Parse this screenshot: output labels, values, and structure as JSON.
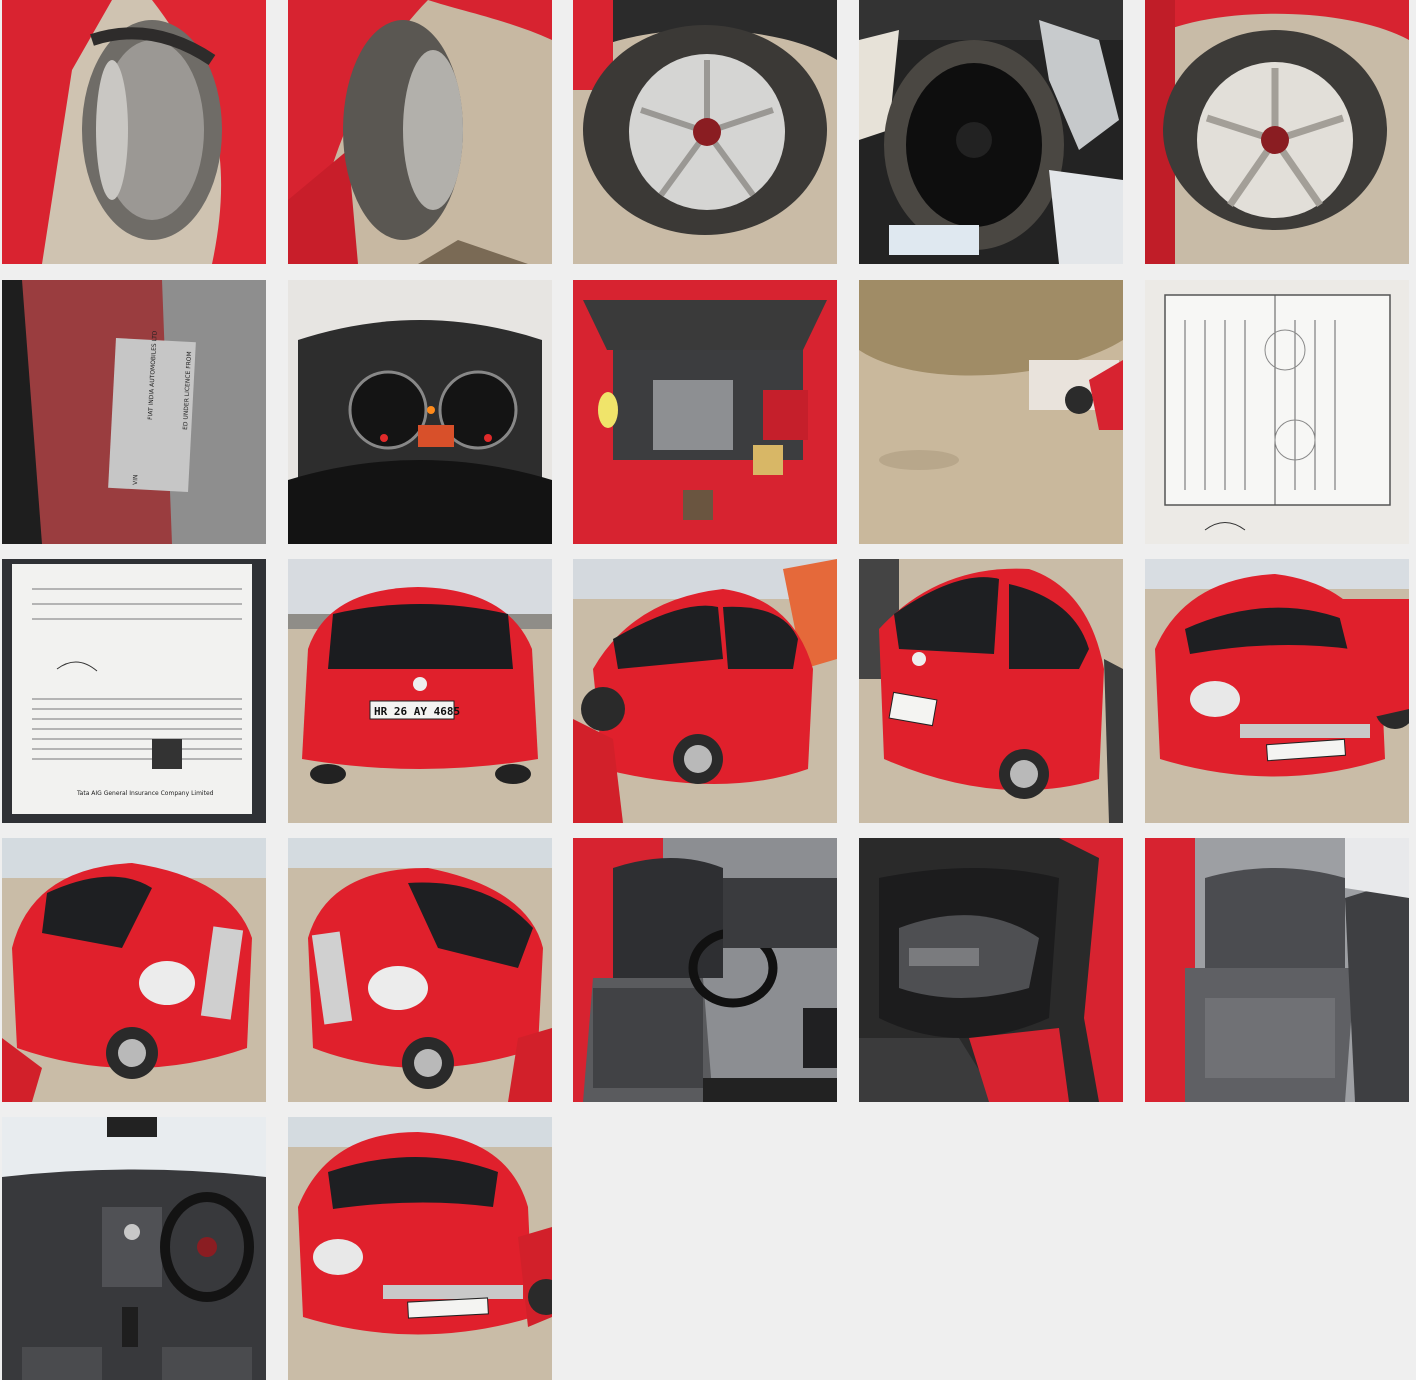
{
  "gallery": {
    "photos": [
      {
        "subject": "front-left-tyre"
      },
      {
        "subject": "front-right-tyre"
      },
      {
        "subject": "rear-tyre-alloy"
      },
      {
        "subject": "spare-wheel"
      },
      {
        "subject": "rear-right-tyre-alloy"
      },
      {
        "subject": "vin-plate"
      },
      {
        "subject": "instrument-cluster"
      },
      {
        "subject": "engine-bay"
      },
      {
        "subject": "underbody"
      },
      {
        "subject": "registration-certificate"
      },
      {
        "subject": "insurance-document"
      },
      {
        "subject": "rear-view"
      },
      {
        "subject": "rear-left-view"
      },
      {
        "subject": "rear-right-view"
      },
      {
        "subject": "front-left-view"
      },
      {
        "subject": "front-right-view"
      },
      {
        "subject": "front-left-angle"
      },
      {
        "subject": "front-cabin"
      },
      {
        "subject": "door-panel"
      },
      {
        "subject": "rear-seat"
      },
      {
        "subject": "dashboard"
      },
      {
        "subject": "front-view"
      }
    ]
  },
  "car": {
    "plate": "HR 26 AY 4685",
    "vin_maker": "FIAT INDIA AUTOMOBILES LTD",
    "vin_licence": "ED UNDER LICENCE FROM",
    "vin_label": "VIN",
    "insurer_footer": "Tata AIG General Insurance Company Limited"
  },
  "colors": {
    "car_red": "#e0202c",
    "ground": "#c8b9a2",
    "background": "#efefef"
  }
}
